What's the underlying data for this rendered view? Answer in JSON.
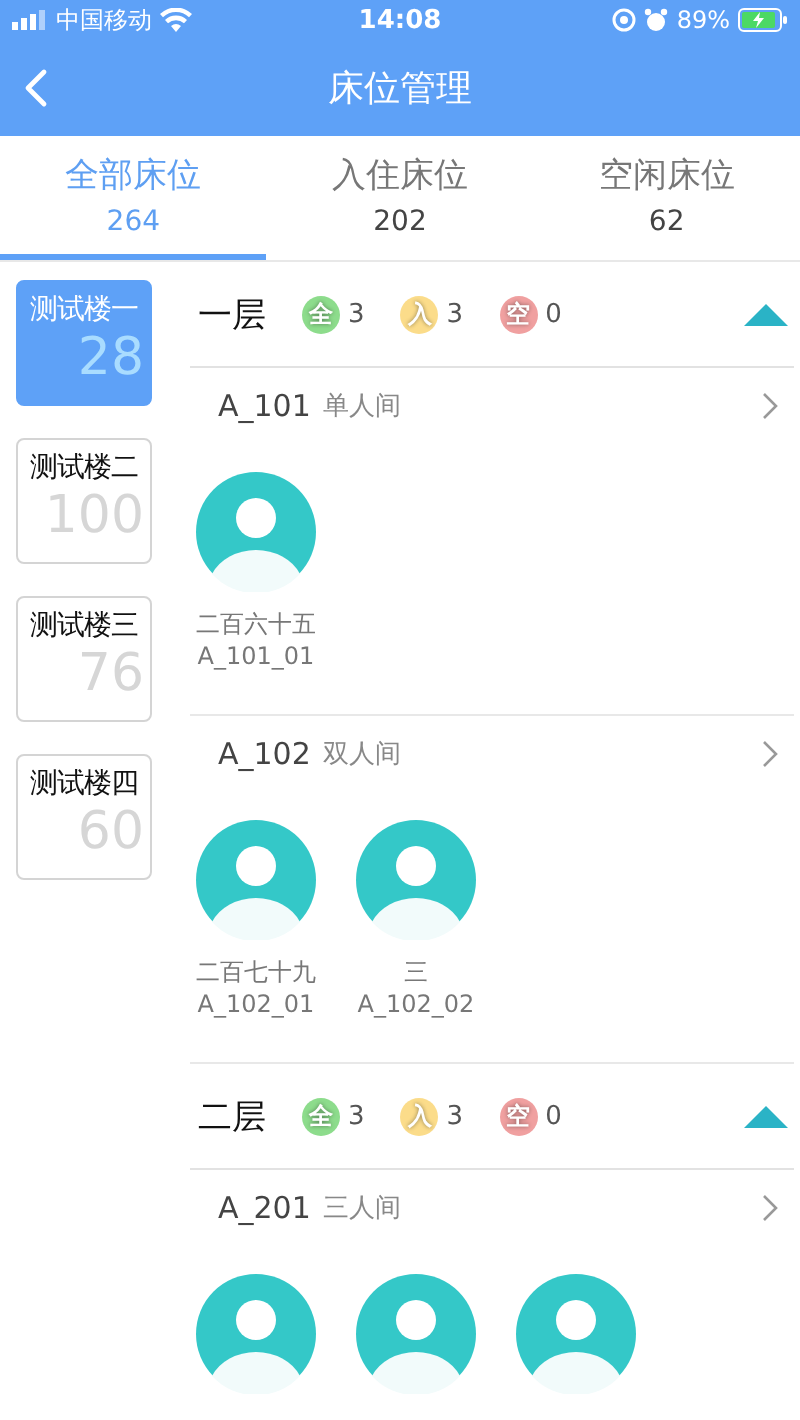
{
  "status_bar": {
    "carrier": "中国移动",
    "time": "14:08",
    "battery": "89%"
  },
  "nav": {
    "title": "床位管理"
  },
  "tabs": [
    {
      "label": "全部床位",
      "count": "264",
      "selected": true
    },
    {
      "label": "入住床位",
      "count": "202",
      "selected": false
    },
    {
      "label": "空闲床位",
      "count": "62",
      "selected": false
    }
  ],
  "buildings": [
    {
      "name": "测试楼一",
      "count": "28",
      "selected": true
    },
    {
      "name": "测试楼二",
      "count": "100",
      "selected": false
    },
    {
      "name": "测试楼三",
      "count": "76",
      "selected": false
    },
    {
      "name": "测试楼四",
      "count": "60",
      "selected": false
    }
  ],
  "floors": [
    {
      "title": "一层",
      "expanded": true,
      "stats": [
        {
          "badge": "全",
          "value": "3",
          "color": "#8ddc8c"
        },
        {
          "badge": "入",
          "value": "3",
          "color": "#fbdc8a"
        },
        {
          "badge": "空",
          "value": "0",
          "color": "#f0a0a0"
        }
      ],
      "rooms": [
        {
          "name": "A_101",
          "type": "单人间",
          "beds": [
            {
              "kind": "occupied",
              "name": "二百六十五",
              "code": "A_101_01"
            }
          ]
        },
        {
          "name": "A_102",
          "type": "双人间",
          "beds": [
            {
              "kind": "occupied",
              "name": "二百七十九",
              "code": "A_102_01"
            },
            {
              "kind": "occupied",
              "name": "三",
              "code": "A_102_02"
            }
          ]
        }
      ]
    },
    {
      "title": "二层",
      "expanded": true,
      "stats": [
        {
          "badge": "全",
          "value": "3",
          "color": "#8ddc8c"
        },
        {
          "badge": "入",
          "value": "3",
          "color": "#fbdc8a"
        },
        {
          "badge": "空",
          "value": "0",
          "color": "#f0a0a0"
        }
      ],
      "rooms": [
        {
          "name": "A_201",
          "type": "三人间",
          "beds": [
            {
              "kind": "occupied"
            },
            {
              "kind": "occupied"
            },
            {
              "kind": "occupied"
            }
          ]
        }
      ]
    }
  ]
}
